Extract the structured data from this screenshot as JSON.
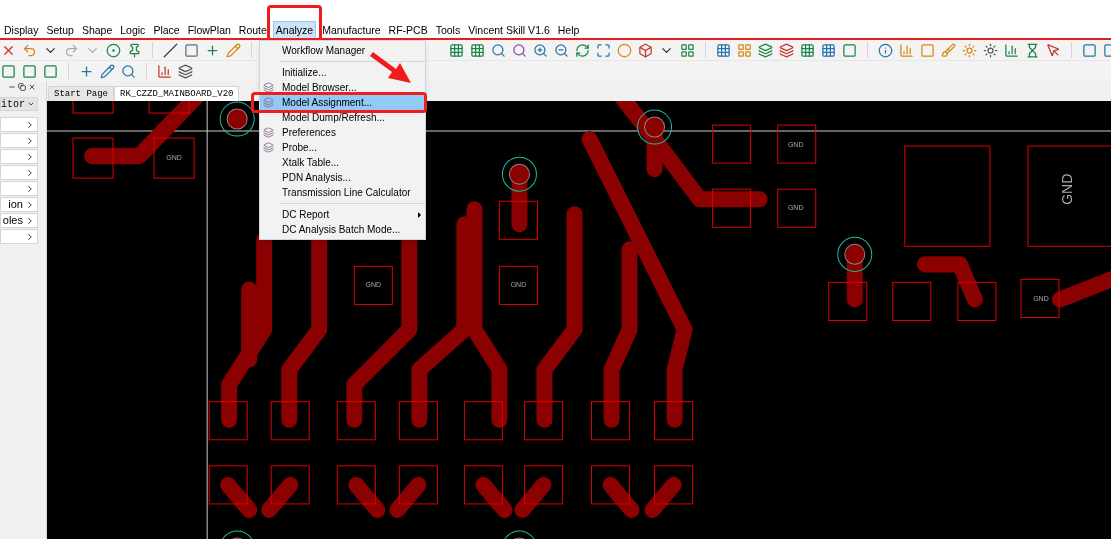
{
  "menubar": [
    {
      "label": "Display",
      "selected": false
    },
    {
      "label": "Setup",
      "selected": false
    },
    {
      "label": "Shape",
      "selected": false
    },
    {
      "label": "Logic",
      "selected": false
    },
    {
      "label": "Place",
      "selected": false
    },
    {
      "label": "FlowPlan",
      "selected": false
    },
    {
      "label": "Route",
      "selected": false
    },
    {
      "label": "Analyze",
      "selected": true
    },
    {
      "label": "Manufacture",
      "selected": false
    },
    {
      "label": "RF-PCB",
      "selected": false
    },
    {
      "label": "Tools",
      "selected": false
    },
    {
      "label": "Vincent Skill V1.6",
      "selected": false
    },
    {
      "label": "Help",
      "selected": false
    }
  ],
  "analyze_menu": [
    {
      "kind": "item",
      "label": "Workflow Manager",
      "selected": false
    },
    {
      "kind": "separator"
    },
    {
      "kind": "item",
      "label": "Initialize...",
      "selected": false
    },
    {
      "kind": "item",
      "label": "Model Browser...",
      "selected": false,
      "icon": true
    },
    {
      "kind": "item",
      "label": "Model Assignment...",
      "selected": true,
      "icon": true
    },
    {
      "kind": "item",
      "label": "Model Dump/Refresh...",
      "selected": false
    },
    {
      "kind": "item",
      "label": "Preferences",
      "selected": false,
      "icon": true
    },
    {
      "kind": "item",
      "label": "Probe...",
      "selected": false,
      "icon": true
    },
    {
      "kind": "item",
      "label": "Xtalk Table...",
      "selected": false
    },
    {
      "kind": "item",
      "label": "PDN Analysis...",
      "selected": false
    },
    {
      "kind": "item",
      "label": "Transmission Line Calculator",
      "selected": false
    },
    {
      "kind": "separator"
    },
    {
      "kind": "item",
      "label": "DC Report",
      "selected": false,
      "submenu": true
    },
    {
      "kind": "item",
      "label": "DC Analysis Batch Mode...",
      "selected": false
    }
  ],
  "side_panel": {
    "dropdown": "itor",
    "rows": [
      {},
      {},
      {},
      {},
      {},
      {
        "label": "ion"
      },
      {
        "label": "oles"
      },
      {}
    ]
  },
  "tabs": [
    {
      "label": "Start Page",
      "selected": false
    },
    {
      "label": "RK_CZZD_MAINBOARD_V20",
      "selected": true
    }
  ],
  "canvas": {
    "pad_labels": [
      "GND",
      "GND",
      "GND",
      "GND",
      "GND",
      "GND"
    ],
    "big_label": "GND"
  }
}
